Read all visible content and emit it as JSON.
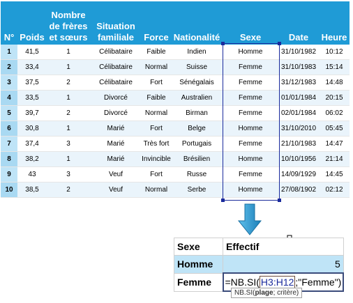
{
  "main_table": {
    "headers": [
      "N°",
      "Poids",
      "Nombre de frères et sœurs",
      "Situation familiale",
      "Force",
      "Nationalité",
      "Sexe",
      "Date",
      "Heure"
    ],
    "rows": [
      [
        "1",
        "41,5",
        "1",
        "Célibataire",
        "Faible",
        "Indien",
        "Homme",
        "31/10/1982",
        "10:12"
      ],
      [
        "2",
        "33,4",
        "1",
        "Célibataire",
        "Normal",
        "Suisse",
        "Femme",
        "31/10/1983",
        "15:14"
      ],
      [
        "3",
        "37,5",
        "2",
        "Célibataire",
        "Fort",
        "Sénégalais",
        "Femme",
        "31/12/1983",
        "14:48"
      ],
      [
        "4",
        "33,5",
        "1",
        "Divorcé",
        "Faible",
        "Australien",
        "Femme",
        "01/01/1984",
        "20:15"
      ],
      [
        "5",
        "39,7",
        "2",
        "Divorcé",
        "Normal",
        "Birman",
        "Femme",
        "02/01/1984",
        "06:02"
      ],
      [
        "6",
        "30,8",
        "1",
        "Marié",
        "Fort",
        "Belge",
        "Homme",
        "31/10/2010",
        "05:45"
      ],
      [
        "7",
        "37,4",
        "3",
        "Marié",
        "Très fort",
        "Portugais",
        "Femme",
        "21/10/1983",
        "14:47"
      ],
      [
        "8",
        "38,2",
        "1",
        "Marié",
        "Invincible",
        "Brésilien",
        "Homme",
        "10/10/1956",
        "21:14"
      ],
      [
        "9",
        "43",
        "3",
        "Veuf",
        "Fort",
        "Russe",
        "Femme",
        "14/09/1929",
        "14:45"
      ],
      [
        "10",
        "38,5",
        "2",
        "Veuf",
        "Normal",
        "Serbe",
        "Homme",
        "27/08/1902",
        "02:12"
      ]
    ]
  },
  "count_table": {
    "header_sexe": "Sexe",
    "header_effectif": "Effectif",
    "homme_label": "Homme",
    "homme_value": "5",
    "femme_label": "Femme",
    "formula": {
      "prefix": "=NB.SI(",
      "range_start": "H3",
      "range_sep": ":",
      "range_end": "H12",
      "suffix": ";\"Femme\")"
    }
  },
  "tooltip": {
    "func": "NB.SI(",
    "bold_arg": "plage",
    "rest": "; critère)"
  },
  "colors": {
    "header_bg": "#1f9bd6",
    "row_number_bg": "#bfe4f7",
    "alt_row_bg": "#eaf4fb",
    "selection": "#1a2a9c",
    "arrow": "#1f9bd6"
  },
  "icons": {
    "arrow": "down-arrow-icon",
    "cursor": "move-cursor-icon"
  }
}
